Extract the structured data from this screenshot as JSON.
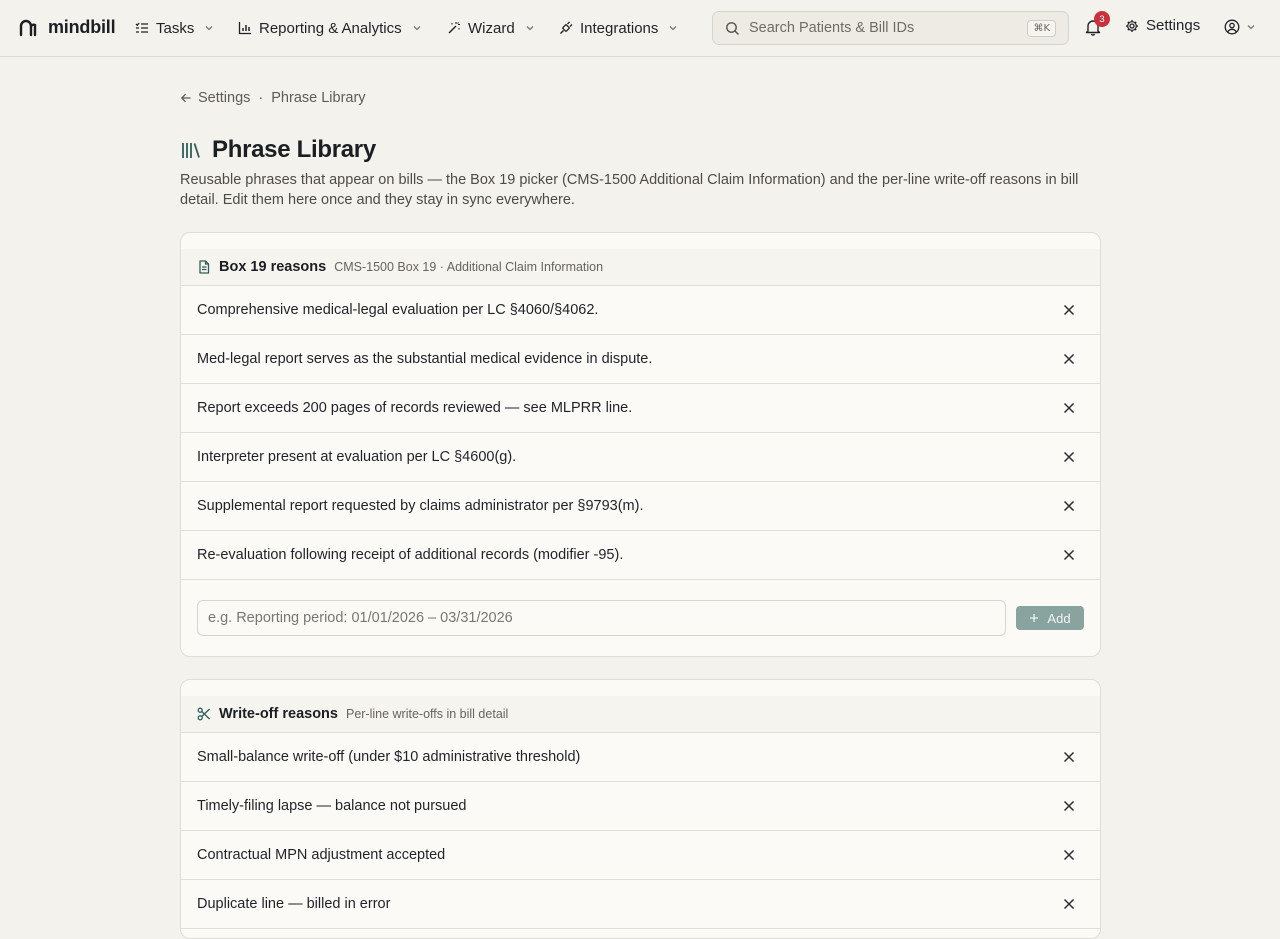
{
  "app": {
    "brand": "mindbill"
  },
  "nav": {
    "items": [
      {
        "label": "Tasks",
        "icon": "list-check-icon"
      },
      {
        "label": "Reporting & Analytics",
        "icon": "bar-chart-icon"
      },
      {
        "label": "Wizard",
        "icon": "magic-wand-icon"
      },
      {
        "label": "Integrations",
        "icon": "plug-icon"
      }
    ],
    "search": {
      "placeholder": "Search Patients & Bill IDs",
      "shortcut": "⌘K"
    },
    "notifications_count": "3",
    "settings_label": "Settings"
  },
  "breadcrumb": {
    "back_label": "Settings",
    "separator": "·",
    "current": "Phrase Library"
  },
  "page": {
    "title": "Phrase Library",
    "description": "Reusable phrases that appear on bills — the Box 19 picker (CMS-1500 Additional Claim Information) and the per-line write-off reasons in bill detail. Edit them here once and they stay in sync everywhere."
  },
  "box19": {
    "title": "Box 19 reasons",
    "subtitle": "CMS-1500 Box 19 · Additional Claim Information",
    "items": [
      "Comprehensive medical-legal evaluation per LC §4060/§4062.",
      "Med-legal report serves as the substantial medical evidence in dispute.",
      "Report exceeds 200 pages of records reviewed — see MLPRR line.",
      "Interpreter present at evaluation per LC §4600(g).",
      "Supplemental report requested by claims administrator per §9793(m).",
      "Re-evaluation following receipt of additional records (modifier -95)."
    ],
    "add_placeholder": "e.g. Reporting period: 01/01/2026 – 03/31/2026",
    "add_label": "Add"
  },
  "writeoff": {
    "title": "Write-off reasons",
    "subtitle": "Per-line write-offs in bill detail",
    "items": [
      "Small-balance write-off (under $10 administrative threshold)",
      "Timely-filing lapse — balance not pursued",
      "Contractual MPN adjustment accepted",
      "Duplicate line — billed in error"
    ]
  },
  "colors": {
    "background": "#f4f2ec",
    "accent": "#2f5e5a",
    "badge": "#c8323a",
    "add_button": "#89a39e"
  }
}
